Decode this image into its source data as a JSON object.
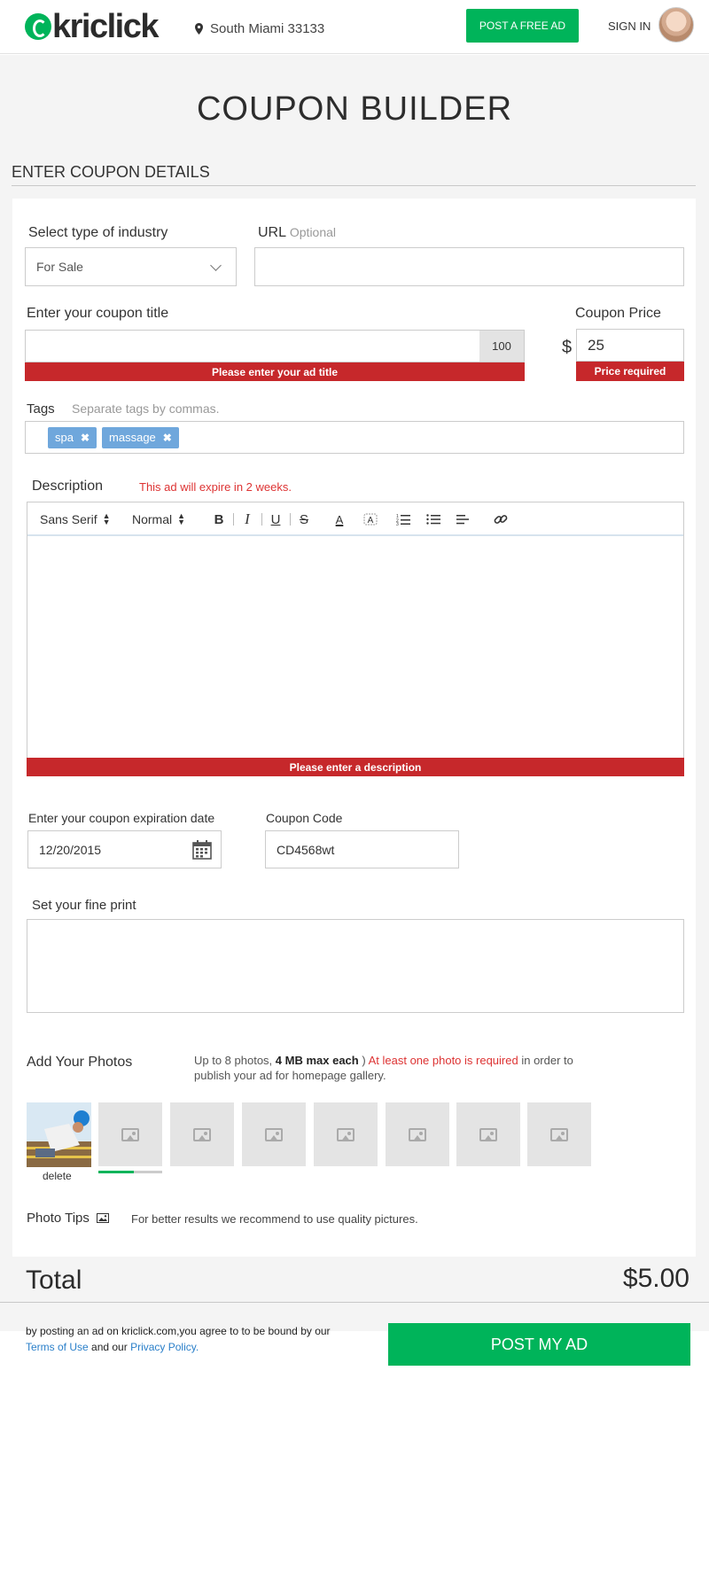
{
  "header": {
    "logo_text": "kriclick",
    "location": "South Miami 33133",
    "post_free_ad": "POST A FREE AD",
    "sign_in": "SIGN IN"
  },
  "page": {
    "title": "COUPON BUILDER",
    "section_title": "ENTER COUPON DETAILS"
  },
  "form": {
    "industry": {
      "label": "Select type of industry",
      "value": "For Sale"
    },
    "url": {
      "label": "URL",
      "optional": "Optional",
      "value": ""
    },
    "coupon_title": {
      "label": "Enter your coupon title",
      "value": "",
      "counter": "100",
      "error": "Please enter your ad title"
    },
    "coupon_price": {
      "label": "Coupon Price",
      "currency": "$",
      "value": "25",
      "error": "Price required"
    },
    "tags": {
      "label": "Tags",
      "hint": "Separate tags by commas.",
      "items": [
        "spa",
        "massage"
      ]
    },
    "description": {
      "label": "Description",
      "expiry_note": "This ad will expire in 2 weeks.",
      "font": "Sans Serif",
      "size": "Normal",
      "error": "Please enter a description"
    },
    "expiration": {
      "label": "Enter your coupon expiration date",
      "value": "12/20/2015"
    },
    "coupon_code": {
      "label": "Coupon Code",
      "value": "CD4568wt"
    },
    "fine_print": {
      "label": "Set your fine print",
      "value": ""
    },
    "photos": {
      "label": "Add Your Photos",
      "info_prefix": "Up to 8 photos,",
      "info_bold": "4 MB max each",
      "info_paren": ")",
      "info_required": "At least one photo is required",
      "info_suffix": "in order to",
      "info_line2": "publish your ad for homepage gallery.",
      "delete_label": "delete",
      "upload_progress": 0.55
    },
    "photo_tips": {
      "label": "Photo Tips",
      "text": "For better results we recommend to use quality pictures."
    }
  },
  "total": {
    "label": "Total",
    "value": "$5.00"
  },
  "footer": {
    "legal_line1": "by posting an ad on kriclick.com,you agree to to be bound by our",
    "terms": "Terms of Use",
    "and_our": "and our",
    "privacy": "Privacy Policy",
    "period": ".",
    "post_button": "POST MY AD"
  },
  "colors": {
    "brand_green": "#00b45a",
    "error_red": "#c6282b",
    "tag_blue": "#6fa7dc",
    "link_blue": "#2a7fc9"
  }
}
